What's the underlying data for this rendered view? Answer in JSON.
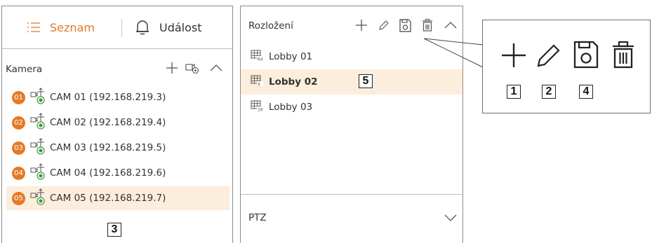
{
  "tabs": {
    "list_label": "Seznam",
    "list_icon": "list-icon",
    "event_label": "Událost",
    "event_icon": "bell-icon"
  },
  "camera_section": {
    "title": "Kamera",
    "cameras": [
      {
        "badge": "01",
        "label": "CAM 01 (192.168.219.3)"
      },
      {
        "badge": "02",
        "label": "CAM 02 (192.168.219.4)"
      },
      {
        "badge": "03",
        "label": "CAM 03 (192.168.219.5)"
      },
      {
        "badge": "04",
        "label": "CAM 04 (192.168.219.6)"
      },
      {
        "badge": "05",
        "label": "CAM 05 (192.168.219.7)"
      }
    ],
    "selected_index": 4,
    "callout": "3"
  },
  "layout_section": {
    "title": "Rozložení",
    "layouts": [
      {
        "label": "Lobby 01",
        "icon": "grid-64-icon"
      },
      {
        "label": "Lobby 02",
        "icon": "grid-9-icon"
      },
      {
        "label": "Lobby 03",
        "icon": "grid-16-icon"
      }
    ],
    "selected_index": 1,
    "callout": "5"
  },
  "ptz_section": {
    "title": "PTZ"
  },
  "zoom_callouts": {
    "add": "1",
    "edit": "2",
    "save": "4"
  },
  "colors": {
    "accent": "#e07b2b",
    "selected_bg": "#fbeedc",
    "badge": "#e47a26"
  }
}
